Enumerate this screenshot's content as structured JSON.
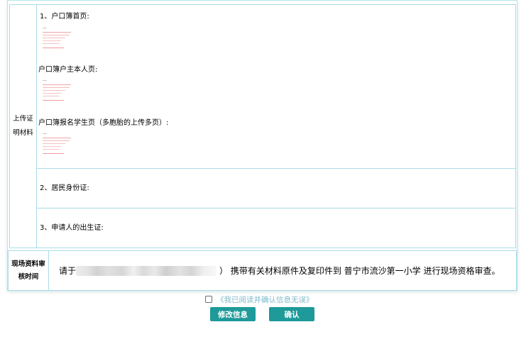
{
  "upload_section": {
    "label_line1": "上传证",
    "label_line2": "明材料",
    "item1_title": "1、户口簿首页:",
    "item1b_title": "户口簿户主本人页:",
    "item1c_title": "户口簿报名学生页（多胞胎的上传多页）:",
    "item2_title": "2、居民身份证:",
    "item3_title": "3、申请人的出生证:"
  },
  "inspection": {
    "label_line1": "现场资料审",
    "label_line2": "核时间",
    "text_prefix": "请于",
    "text_suffix": "）  携带有关材料原件及复印件到 普宁市流沙第一小学 进行现场资格审查。"
  },
  "confirm": {
    "checkbox_label": "《我已阅读并确认信息无误》"
  },
  "buttons": {
    "edit_label": "修改信息",
    "ok_label": "确认"
  },
  "colors": {
    "border": "#a9dce8",
    "button": "#1d9a99",
    "link": "#7fb9cc"
  }
}
